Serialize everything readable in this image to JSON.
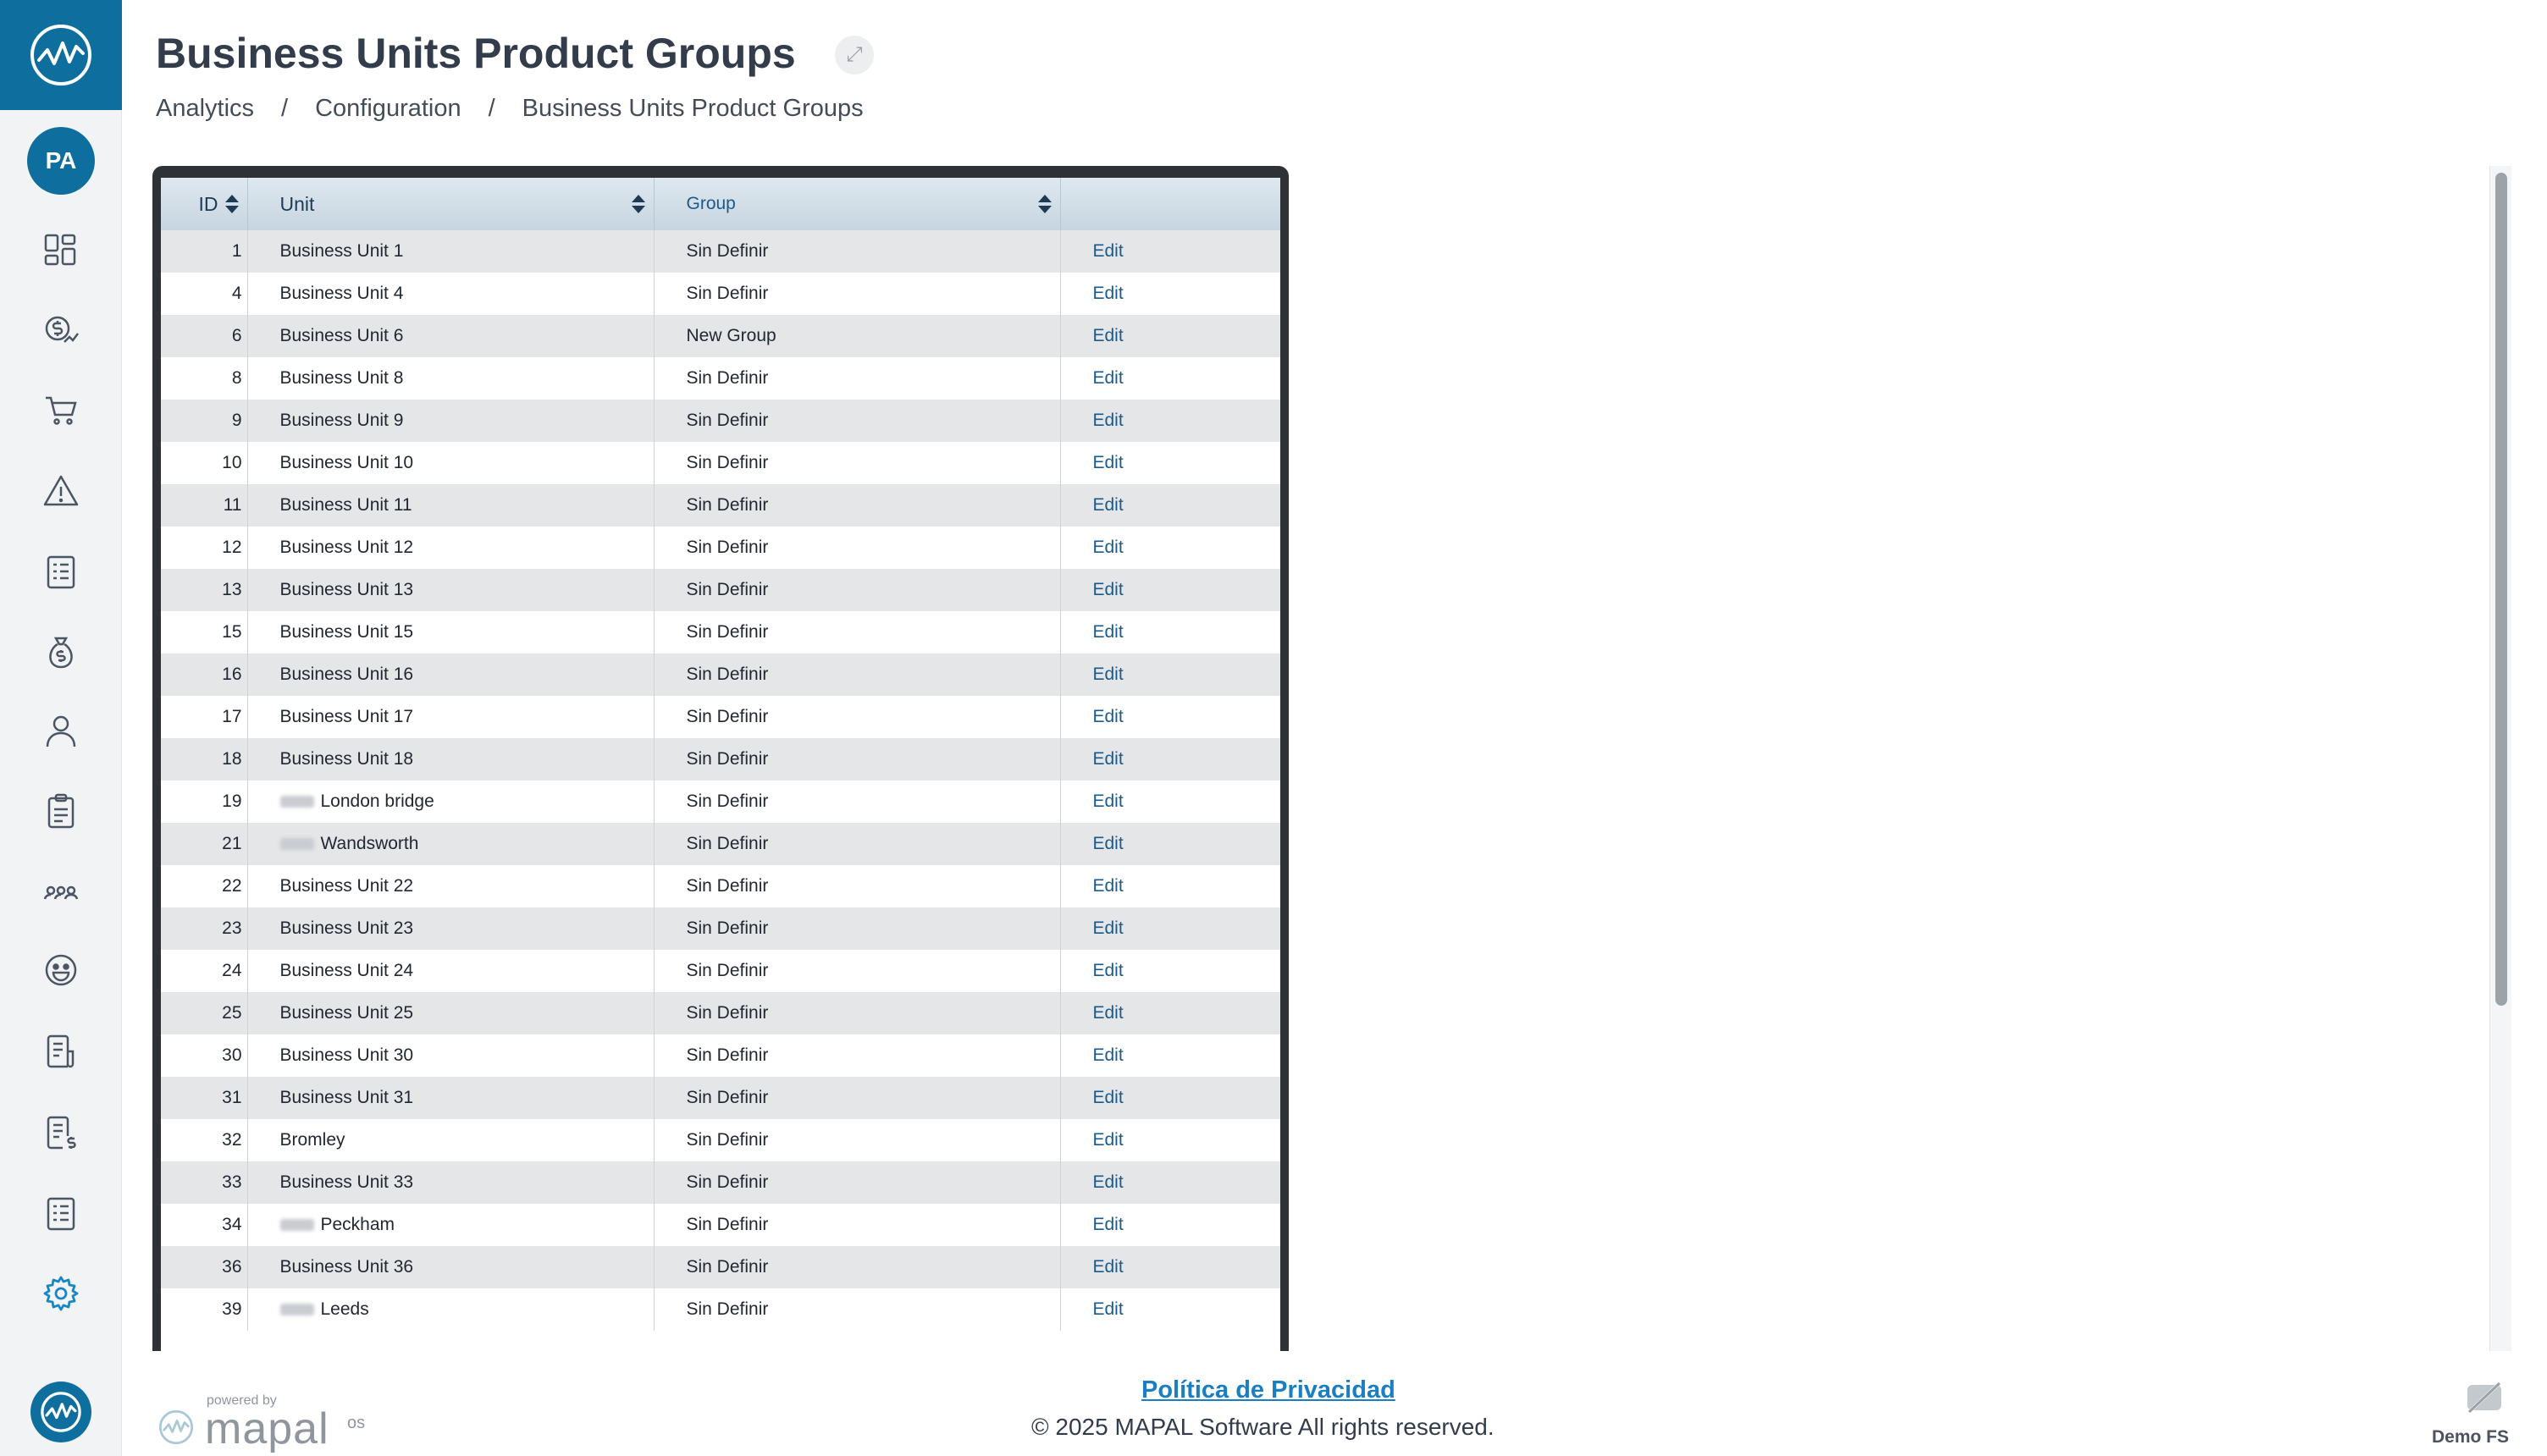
{
  "header": {
    "title": "Business Units Product Groups",
    "breadcrumb": [
      "Analytics",
      "Configuration",
      "Business Units Product Groups"
    ],
    "breadcrumb_separator": "/"
  },
  "sidebar": {
    "avatar_initials": "PA",
    "nav_icons": [
      "dashboard-icon",
      "money-growth-icon",
      "cart-icon",
      "alert-icon",
      "list-icon",
      "money-bag-icon",
      "user-icon",
      "clipboard-icon",
      "people-icon",
      "smile-icon",
      "report-icon",
      "invoice-icon",
      "checklist-icon",
      "settings-icon"
    ],
    "active_icon": "settings-icon",
    "accent_color": "#0e6f9e"
  },
  "table": {
    "columns": [
      "ID",
      "Unit",
      "Group",
      ""
    ],
    "edit_label": "Edit",
    "rows": [
      {
        "id": "1",
        "unit": "Business Unit 1",
        "group": "Sin Definir",
        "redacted": false
      },
      {
        "id": "4",
        "unit": "Business Unit 4",
        "group": "Sin Definir",
        "redacted": false
      },
      {
        "id": "6",
        "unit": "Business Unit 6",
        "group": "New Group",
        "redacted": false
      },
      {
        "id": "8",
        "unit": "Business Unit 8",
        "group": "Sin Definir",
        "redacted": false
      },
      {
        "id": "9",
        "unit": "Business Unit 9",
        "group": "Sin Definir",
        "redacted": false
      },
      {
        "id": "10",
        "unit": "Business Unit 10",
        "group": "Sin Definir",
        "redacted": false
      },
      {
        "id": "11",
        "unit": "Business Unit 11",
        "group": "Sin Definir",
        "redacted": false
      },
      {
        "id": "12",
        "unit": "Business Unit 12",
        "group": "Sin Definir",
        "redacted": false
      },
      {
        "id": "13",
        "unit": "Business Unit 13",
        "group": "Sin Definir",
        "redacted": false
      },
      {
        "id": "15",
        "unit": "Business Unit 15",
        "group": "Sin Definir",
        "redacted": false
      },
      {
        "id": "16",
        "unit": "Business Unit 16",
        "group": "Sin Definir",
        "redacted": false
      },
      {
        "id": "17",
        "unit": "Business Unit 17",
        "group": "Sin Definir",
        "redacted": false
      },
      {
        "id": "18",
        "unit": "Business Unit 18",
        "group": "Sin Definir",
        "redacted": false
      },
      {
        "id": "19",
        "unit": "London bridge",
        "group": "Sin Definir",
        "redacted": true
      },
      {
        "id": "21",
        "unit": "Wandsworth",
        "group": "Sin Definir",
        "redacted": true
      },
      {
        "id": "22",
        "unit": "Business Unit 22",
        "group": "Sin Definir",
        "redacted": false
      },
      {
        "id": "23",
        "unit": "Business Unit 23",
        "group": "Sin Definir",
        "redacted": false
      },
      {
        "id": "24",
        "unit": "Business Unit 24",
        "group": "Sin Definir",
        "redacted": false
      },
      {
        "id": "25",
        "unit": "Business Unit 25",
        "group": "Sin Definir",
        "redacted": false
      },
      {
        "id": "30",
        "unit": "Business Unit 30",
        "group": "Sin Definir",
        "redacted": false
      },
      {
        "id": "31",
        "unit": "Business Unit 31",
        "group": "Sin Definir",
        "redacted": false
      },
      {
        "id": "32",
        "unit": "Bromley",
        "group": "Sin Definir",
        "redacted": false
      },
      {
        "id": "33",
        "unit": "Business Unit 33",
        "group": "Sin Definir",
        "redacted": false
      },
      {
        "id": "34",
        "unit": "Peckham",
        "group": "Sin Definir",
        "redacted": true
      },
      {
        "id": "36",
        "unit": "Business Unit 36",
        "group": "Sin Definir",
        "redacted": false
      },
      {
        "id": "39",
        "unit": "Leeds",
        "group": "Sin Definir",
        "redacted": true
      }
    ]
  },
  "footer": {
    "powered_by": "powered by",
    "brand": "mapal",
    "brand_suffix": "os",
    "privacy_link": "Política de Privacidad",
    "copyright": "© 2025 MAPAL Software All rights reserved.",
    "environment": "Demo FS"
  }
}
